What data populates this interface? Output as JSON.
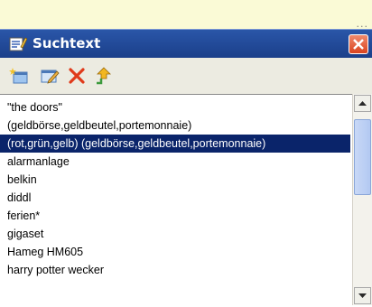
{
  "top_strip": {
    "ellipsis": "..."
  },
  "panel": {
    "title": "Suchtext"
  },
  "toolbar": {
    "buttons": [
      {
        "name": "new-entry-icon"
      },
      {
        "name": "edit-icon"
      },
      {
        "name": "delete-icon"
      },
      {
        "name": "upload-icon"
      }
    ]
  },
  "list": {
    "items": [
      {
        "label": "\"the doors\"",
        "selected": false
      },
      {
        "label": "(geldbörse,geldbeutel,portemonnaie)",
        "selected": false
      },
      {
        "label": "(rot,grün,gelb) (geldbörse,geldbeutel,portemonnaie)",
        "selected": true
      },
      {
        "label": "alarmanlage",
        "selected": false
      },
      {
        "label": "belkin",
        "selected": false
      },
      {
        "label": "diddl",
        "selected": false
      },
      {
        "label": "ferien*",
        "selected": false
      },
      {
        "label": "gigaset",
        "selected": false
      },
      {
        "label": "Hameg HM605",
        "selected": false
      },
      {
        "label": "harry potter wecker",
        "selected": false
      }
    ]
  },
  "colors": {
    "title_bar": "#1b3f8a",
    "selection": "#0a246a",
    "close_button": "#d9431f"
  }
}
